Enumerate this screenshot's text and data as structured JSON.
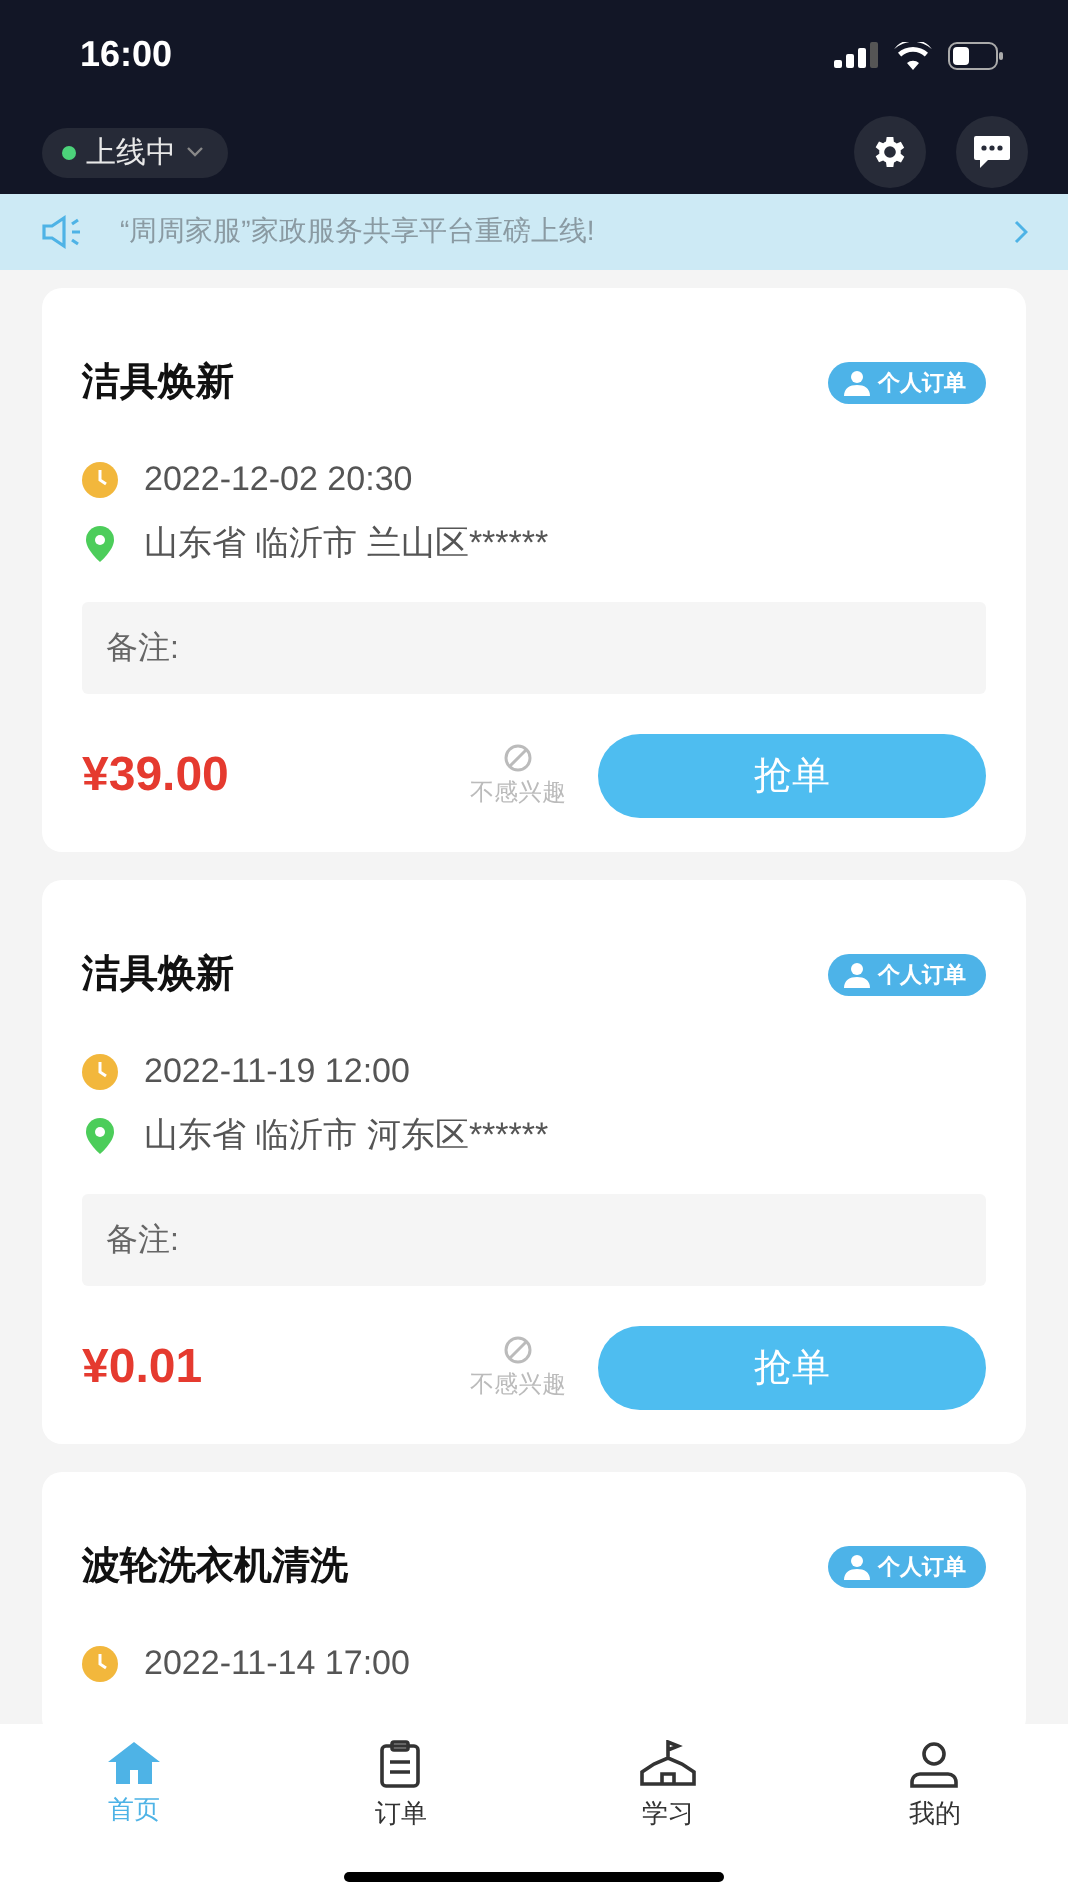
{
  "status_bar": {
    "time": "16:00"
  },
  "header": {
    "status": {
      "label": "上线中",
      "online": true
    }
  },
  "banner": {
    "text": "“周周家服”家政服务共享平台重磅上线!"
  },
  "orders": [
    {
      "title": "洁具焕新",
      "tag": "个人订单",
      "datetime": "2022-12-02 20:30",
      "address": "山东省 临沂市 兰山区******",
      "note_label": "备注:",
      "price": "¥39.00",
      "dismiss": "不感兴趣",
      "action": "抢单"
    },
    {
      "title": "洁具焕新",
      "tag": "个人订单",
      "datetime": "2022-11-19 12:00",
      "address": "山东省 临沂市 河东区******",
      "note_label": "备注:",
      "price": "¥0.01",
      "dismiss": "不感兴趣",
      "action": "抢单"
    },
    {
      "title": "波轮洗衣机清洗",
      "tag": "个人订单",
      "datetime": "2022-11-14 17:00"
    }
  ],
  "tab_bar": [
    {
      "label": "首页",
      "kind": "home",
      "selected": true
    },
    {
      "label": "订单",
      "kind": "orders",
      "selected": false
    },
    {
      "label": "学习",
      "kind": "study",
      "selected": false
    },
    {
      "label": "我的",
      "kind": "profile",
      "selected": false
    }
  ]
}
